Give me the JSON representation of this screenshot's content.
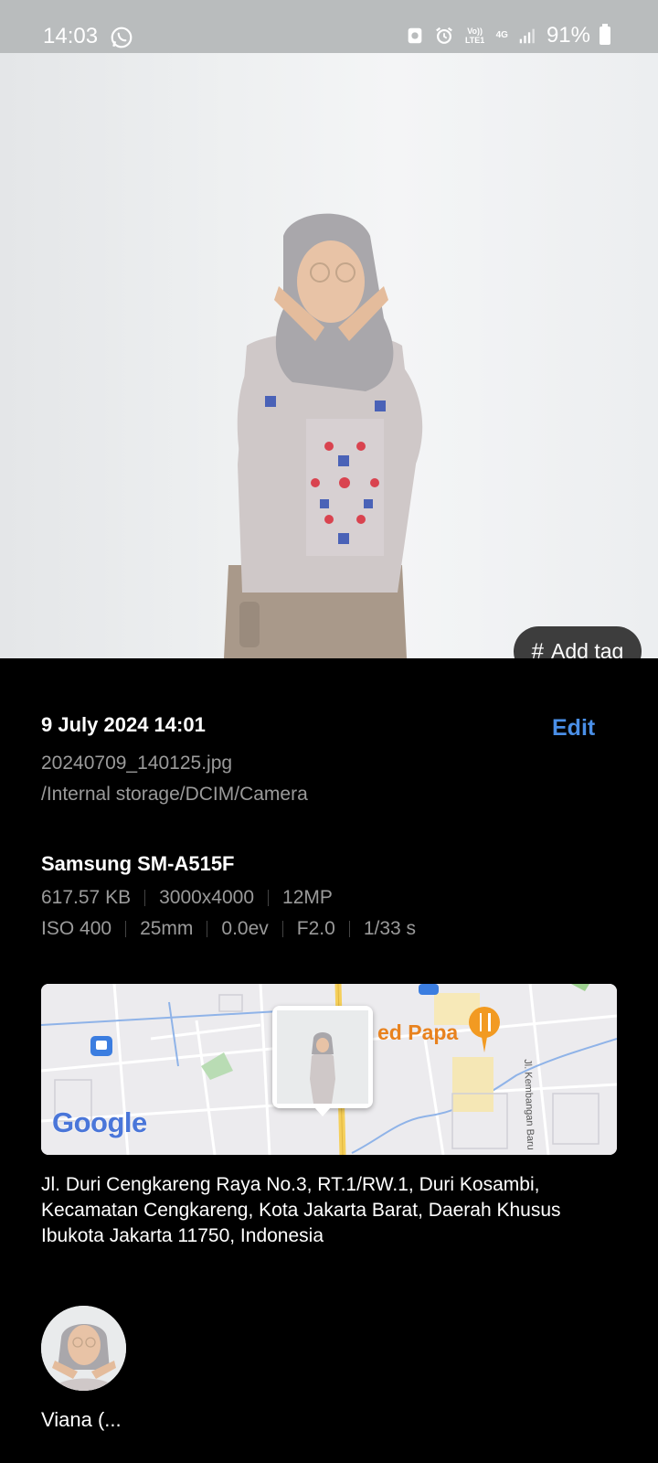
{
  "status_bar": {
    "time": "14:03",
    "network_volte": "Vo)) LTE1",
    "network_type": "4G",
    "battery": "91%"
  },
  "photo": {
    "add_tag_label": "Add tag",
    "add_tag_icon": "#"
  },
  "details": {
    "date_time": "9 July 2024 14:01",
    "edit_label": "Edit",
    "filename": "20240709_140125.jpg",
    "path": "/Internal storage/DCIM/Camera",
    "device": "Samsung SM-A515F",
    "specs_row1": [
      "617.57 KB",
      "3000x4000",
      "12MP"
    ],
    "specs_row2": [
      "ISO 400",
      "25mm",
      "0.0ev",
      "F2.0",
      "1/33 s"
    ]
  },
  "map": {
    "place_label": "ed Papa",
    "road_label": "Jl. Kembangan Baru",
    "google_logo": "Google"
  },
  "location": {
    "address": "Jl. Duri Cengkareng Raya No.3, RT.1/RW.1, Duri Kosambi, Kecamatan Cengkareng, Kota Jakarta Barat, Daerah Khusus Ibukota Jakarta 11750, Indonesia"
  },
  "people": {
    "name": "Viana (..."
  },
  "colors": {
    "accent": "#4a8fe7",
    "secondary_text": "#9a9a9a",
    "background": "#000000",
    "tag_button": "#3d3d3d"
  }
}
